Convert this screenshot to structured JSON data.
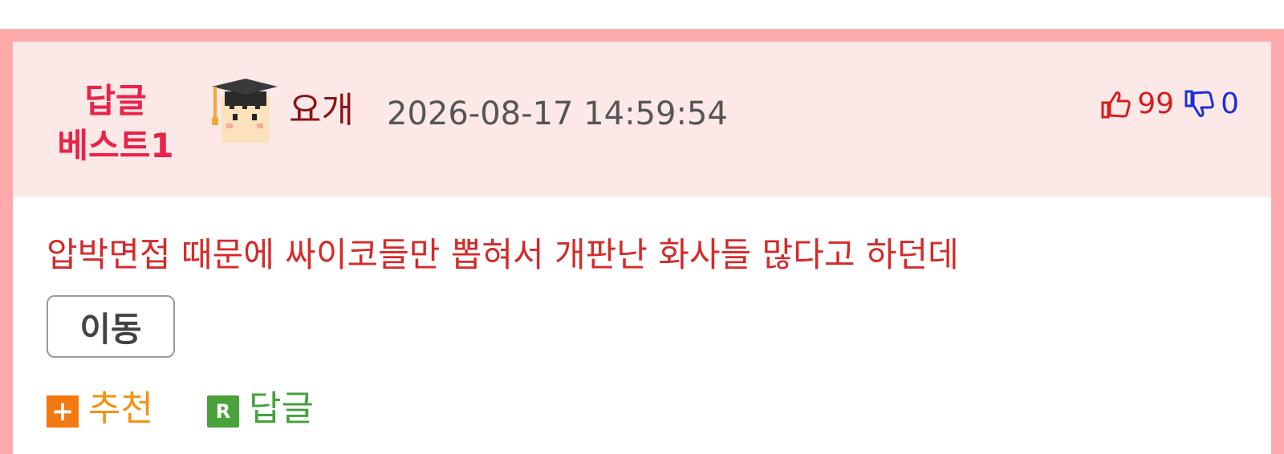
{
  "comment": {
    "best_line1": "답글",
    "best_line2": "베스트1",
    "author": "요개",
    "datetime": "2026-08-17 14:59:54",
    "upvotes": "99",
    "downvotes": "0",
    "body": "압박면접 때문에 싸이코들만 뽑혀서 개판난 화사들 많다고 하던데",
    "move_label": "이동",
    "recommend_label": "추천",
    "reply_label": "답글",
    "recommend_badge": "+",
    "reply_badge": "R"
  },
  "colors": {
    "frame": "#ffaaaa",
    "header_bg": "#fde8e8",
    "best": "#e8234a",
    "body_text": "#d42a2a",
    "upvote": "#d81c1c",
    "downvote": "#1c2fd8",
    "recommend": "#f39313",
    "reply": "#45a23d"
  },
  "icons": {
    "avatar": "graduate-avatar-icon",
    "upvote": "thumbs-up-icon",
    "downvote": "thumbs-down-icon",
    "recommend": "plus-badge-icon",
    "reply": "r-badge-icon"
  }
}
